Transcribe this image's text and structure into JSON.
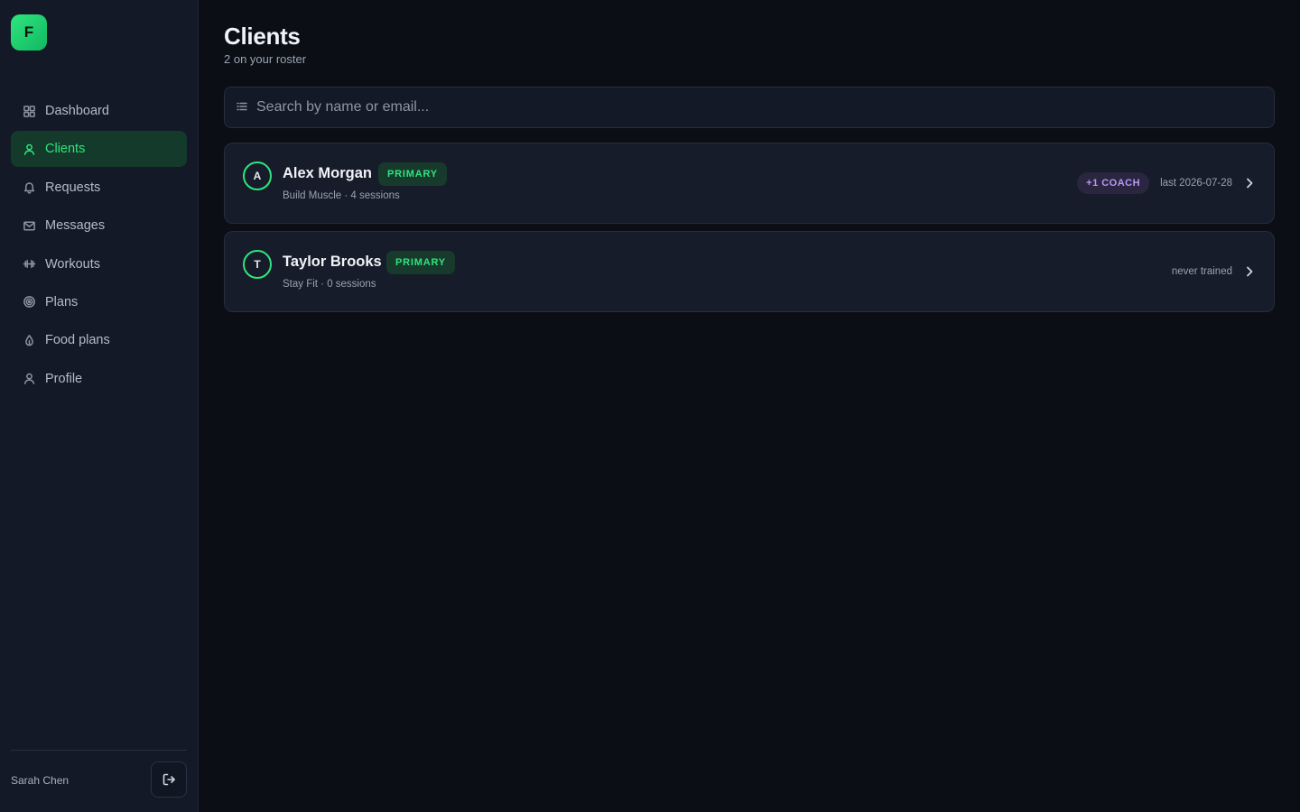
{
  "app": {
    "logo_letter": "F"
  },
  "sidebar": {
    "items": [
      {
        "label": "Dashboard",
        "icon": "grid-icon"
      },
      {
        "label": "Clients",
        "icon": "user-icon",
        "active": true
      },
      {
        "label": "Requests",
        "icon": "bell-icon"
      },
      {
        "label": "Messages",
        "icon": "mail-icon"
      },
      {
        "label": "Workouts",
        "icon": "dumbbell-icon"
      },
      {
        "label": "Plans",
        "icon": "target-icon"
      },
      {
        "label": "Food plans",
        "icon": "leaf-icon"
      },
      {
        "label": "Profile",
        "icon": "user-icon"
      }
    ],
    "user_name": "Sarah Chen",
    "logout_icon": "logout-icon"
  },
  "page": {
    "title": "Clients",
    "subtitle": "2 on your roster"
  },
  "search": {
    "placeholder": "Search by name or email..."
  },
  "clients": [
    {
      "initial": "A",
      "name": "Alex Morgan",
      "badge": "PRIMARY",
      "meta": "Build Muscle · 4 sessions",
      "coach_badge": "+1 COACH",
      "last": "last 2026-07-28"
    },
    {
      "initial": "T",
      "name": "Taylor Brooks",
      "badge": "PRIMARY",
      "meta": "Stay Fit · 0 sessions",
      "coach_badge": "",
      "last": "never trained"
    }
  ],
  "colors": {
    "accent": "#2ee57e",
    "background": "#0b0e14",
    "sidebar": "#131926",
    "coach_badge": "#b797f5"
  }
}
